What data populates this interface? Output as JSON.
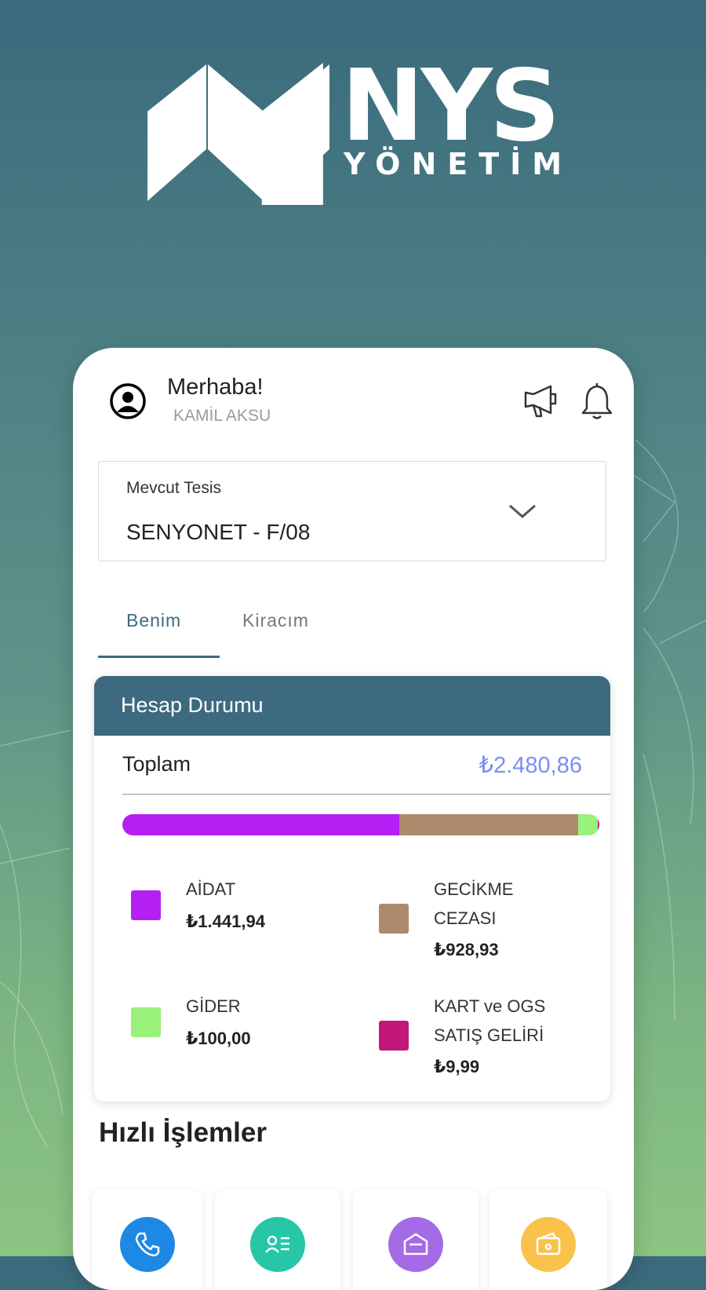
{
  "brand": {
    "name": "NYS",
    "subtitle": "YÖNETİM"
  },
  "header": {
    "greeting": "Merhaba!",
    "user_name": "KAMİL AKSU",
    "icons": [
      "user-avatar-icon",
      "megaphone-icon",
      "bell-icon"
    ]
  },
  "facility_select": {
    "label": "Mevcut Tesis",
    "value": "SENYONET - F/08",
    "icon": "chevron-down-icon"
  },
  "tabs": [
    {
      "label": "Benim",
      "active": true
    },
    {
      "label": "Kiracım",
      "active": false
    }
  ],
  "account": {
    "title": "Hesap Durumu",
    "total_label": "Toplam",
    "total_value": "₺2.480,86",
    "items": [
      {
        "label": "AİDAT",
        "value": "₺1.441,94",
        "color": "#b41ff3",
        "amount": 1441.94
      },
      {
        "label": "GECİKME\nCEZASI",
        "value": "₺928,93",
        "color": "#ad8a6c",
        "amount": 928.93
      },
      {
        "label": "GİDER",
        "value": "₺100,00",
        "color": "#99f07a",
        "amount": 100.0
      },
      {
        "label": "KART ve OGS\nSATIŞ GELİRİ",
        "value": "₺9,99",
        "color": "#c2177a",
        "amount": 9.99
      }
    ]
  },
  "quick_actions": {
    "title": "Hızlı İşlemler",
    "items": [
      {
        "icon": "phone-icon",
        "color": "#1e88e5"
      },
      {
        "icon": "contact-card-icon",
        "color": "#26c6a6"
      },
      {
        "icon": "building-icon",
        "color": "#a56ae6"
      },
      {
        "icon": "wallet-icon",
        "color": "#f8c24b"
      }
    ]
  },
  "colors": {
    "primary": "#3e6a80",
    "accent": "#7b8ff0"
  }
}
